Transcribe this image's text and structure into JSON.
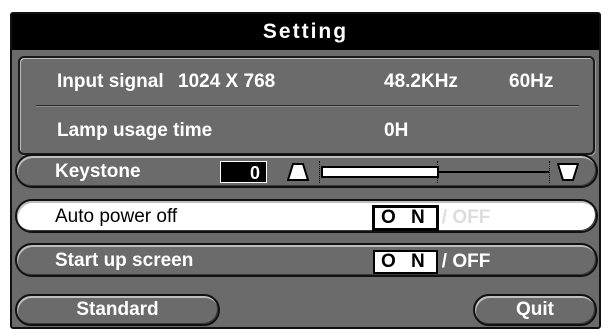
{
  "title": "Setting",
  "info": {
    "input_signal_label": "Input signal",
    "resolution": "1024 X  768",
    "h_freq": "48.2KHz",
    "v_freq": "60Hz",
    "lamp_label": "Lamp usage time",
    "lamp_value": "0H"
  },
  "keystone": {
    "label": "Keystone",
    "value": "0",
    "level": 0.5
  },
  "auto_power_off": {
    "label": "Auto power off",
    "on": "O N",
    "off": "/ OFF"
  },
  "start_up_screen": {
    "label": "Start up screen",
    "on": "O N",
    "off": "/ OFF"
  },
  "buttons": {
    "standard": "Standard",
    "quit": "Quit"
  },
  "colors": {
    "panel": "#6b6b6b",
    "title_bg": "#000000",
    "highlight": "#ffffff"
  }
}
